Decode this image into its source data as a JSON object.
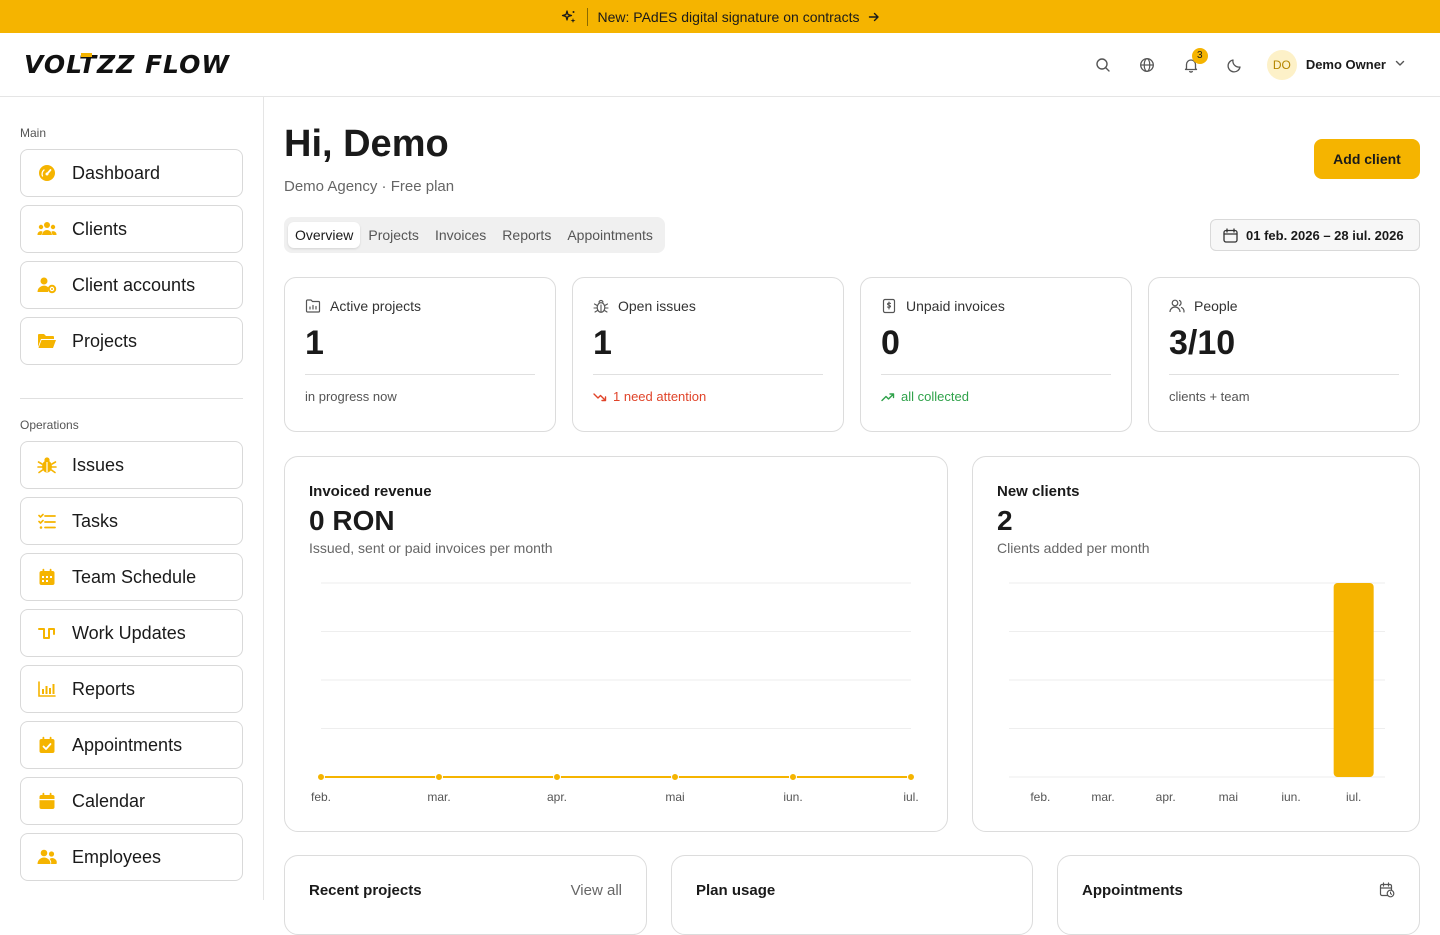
{
  "announcement": {
    "text": "New: PAdES digital signature on contracts"
  },
  "brand": {
    "logo_pre": "VOL",
    "logo_t": "T",
    "logo_post": "ZZ FLOW",
    "accent": "#f5b400"
  },
  "header": {
    "notification_count": "3",
    "user_initials": "DO",
    "user_name": "Demo Owner"
  },
  "sidebar": {
    "main_label": "Main",
    "main_items": [
      {
        "label": "Dashboard",
        "icon": "gauge-icon"
      },
      {
        "label": "Clients",
        "icon": "users-icon"
      },
      {
        "label": "Client accounts",
        "icon": "user-gear-icon"
      },
      {
        "label": "Projects",
        "icon": "folder-icon"
      }
    ],
    "ops_label": "Operations",
    "ops_items": [
      {
        "label": "Issues",
        "icon": "bug-icon"
      },
      {
        "label": "Tasks",
        "icon": "list-check-icon"
      },
      {
        "label": "Team Schedule",
        "icon": "calendar-grid-icon"
      },
      {
        "label": "Work Updates",
        "icon": "pulse-icon"
      },
      {
        "label": "Reports",
        "icon": "bar-chart-icon"
      },
      {
        "label": "Appointments",
        "icon": "calendar-check-icon"
      },
      {
        "label": "Calendar",
        "icon": "calendar-icon"
      },
      {
        "label": "Employees",
        "icon": "team-icon"
      }
    ]
  },
  "page": {
    "greeting": "Hi, Demo",
    "subtitle": "Demo Agency · Free plan",
    "add_button": "Add client",
    "tabs": [
      "Overview",
      "Projects",
      "Invoices",
      "Reports",
      "Appointments"
    ],
    "active_tab": "Overview",
    "date_range": "01 feb. 2026 – 28 iul. 2026"
  },
  "stats": [
    {
      "label": "Active projects",
      "value": "1",
      "foot": "in progress now",
      "icon": "folder-chart-icon"
    },
    {
      "label": "Open issues",
      "value": "1",
      "foot": "1 need attention",
      "icon": "bug-outline-icon"
    },
    {
      "label": "Unpaid invoices",
      "value": "0",
      "foot": "all collected",
      "icon": "invoice-icon"
    },
    {
      "label": "People",
      "value": "3/10",
      "foot": "clients + team",
      "icon": "people-icon"
    }
  ],
  "revenue": {
    "title": "Invoiced revenue",
    "value": "0 RON",
    "subtitle": "Issued, sent or paid invoices per month"
  },
  "clients": {
    "title": "New clients",
    "value": "2",
    "subtitle": "Clients added per month"
  },
  "chart_data": [
    {
      "type": "line",
      "title": "Invoiced revenue",
      "categories": [
        "feb.",
        "mar.",
        "apr.",
        "mai",
        "iun.",
        "iul."
      ],
      "series": [
        {
          "values": [
            0,
            0,
            0,
            0,
            0,
            0
          ]
        }
      ],
      "grid": true,
      "color": "#f5b400"
    },
    {
      "type": "bar",
      "title": "New clients",
      "categories": [
        "feb.",
        "mar.",
        "apr.",
        "mai",
        "iun.",
        "iul."
      ],
      "values": [
        0,
        0,
        0,
        0,
        0,
        2
      ],
      "ylim": [
        0,
        2
      ],
      "grid": true,
      "color": "#f5b400"
    }
  ],
  "bottom": {
    "recent_projects": "Recent projects",
    "view_all": "View all",
    "plan_usage": "Plan usage",
    "appointments": "Appointments"
  }
}
